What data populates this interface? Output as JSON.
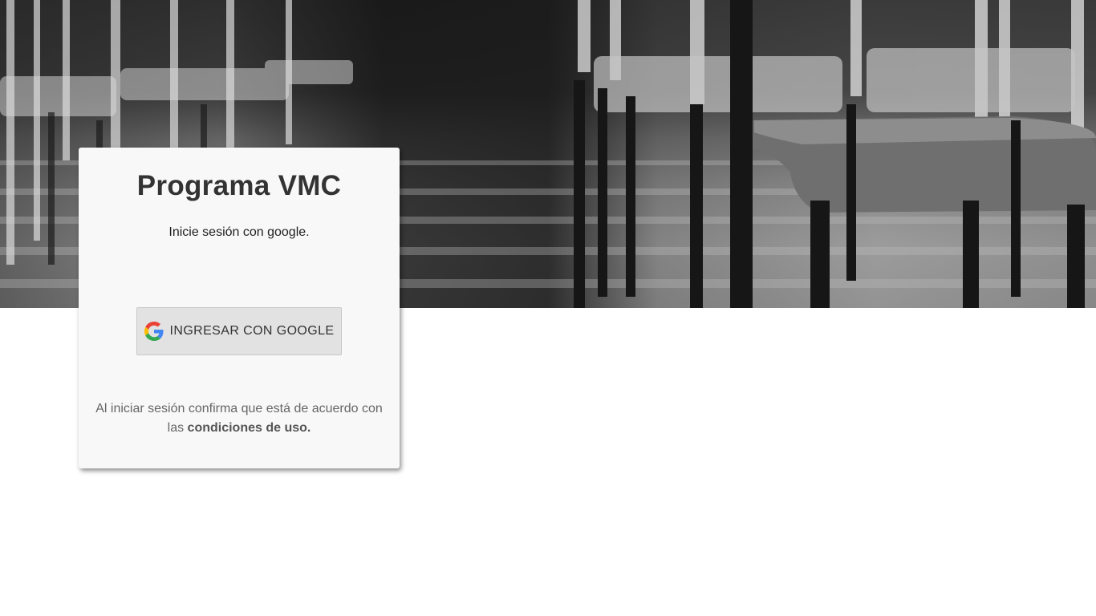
{
  "hero": {
    "image_description_icon": "chairs-photo"
  },
  "login_card": {
    "title": "Programa VMC",
    "subtitle": "Inicie sesión con google.",
    "google_button_label": "INGRESAR CON GOOGLE",
    "google_icon": "google-g-icon",
    "terms_prefix": "Al iniciar sesión confirma que está de acuerdo con las ",
    "terms_link": "condiciones de uso."
  },
  "colors": {
    "card_background": "#f8f8f8",
    "button_background": "#e2e2e2",
    "title_color": "#333333",
    "terms_color": "#666666"
  }
}
